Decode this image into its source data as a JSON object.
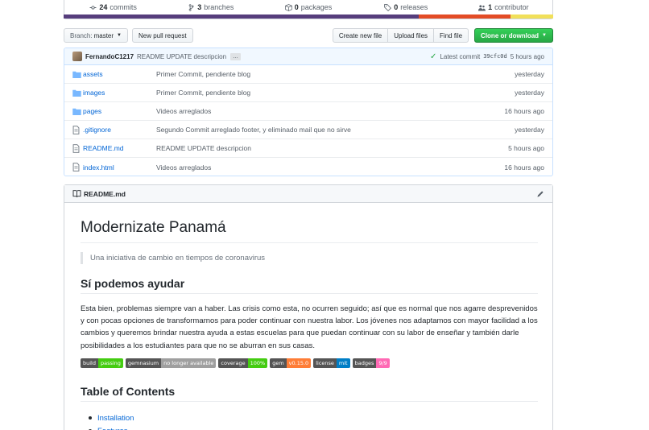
{
  "summary": {
    "commits": {
      "count": "24",
      "label": "commits"
    },
    "branches": {
      "count": "3",
      "label": "branches"
    },
    "packages": {
      "count": "0",
      "label": "packages"
    },
    "releases": {
      "count": "0",
      "label": "releases"
    },
    "contributors": {
      "count": "1",
      "label": "contributor"
    },
    "language_colors": [
      "#563d7c",
      "#e34c26",
      "#f1e05a"
    ]
  },
  "toolbar": {
    "branch_prefix": "Branch:",
    "branch_name": "master",
    "new_pull_request": "New pull request",
    "create_new_file": "Create new file",
    "upload_files": "Upload files",
    "find_file": "Find file",
    "clone_or_download": "Clone or download"
  },
  "latest_commit": {
    "author": "FernandoC1217",
    "message": "README UPDATE descripcion",
    "ellipsis": "…",
    "label": "Latest commit",
    "sha": "39cfc0d",
    "age": "5 hours ago"
  },
  "files": [
    {
      "name": "assets",
      "type": "folder",
      "commit": "Primer Commit, pendiente blog",
      "age": "yesterday"
    },
    {
      "name": "images",
      "type": "folder",
      "commit": "Primer Commit, pendiente blog",
      "age": "yesterday"
    },
    {
      "name": "pages",
      "type": "folder",
      "commit": "Videos arreglados",
      "age": "16 hours ago"
    },
    {
      "name": ".gitignore",
      "type": "file",
      "commit": "Segundo Commit arreglado footer, y eliminado mail que no sirve",
      "age": "yesterday"
    },
    {
      "name": "README.md",
      "type": "file",
      "commit": "README UPDATE descripcion",
      "age": "5 hours ago"
    },
    {
      "name": "index.html",
      "type": "file",
      "commit": "Videos arreglados",
      "age": "16 hours ago"
    }
  ],
  "readme": {
    "filename": "README.md",
    "title": "Modernizate Panamá",
    "tagline": "Una iniciativa de cambio en tiempos de coronavirus",
    "section_heading": "Sí podemos ayudar",
    "paragraph": "Esta bien, problemas siempre van a haber. Las crisis como esta, no ocurren seguido; así que es normal que nos agarre desprevenidos y con pocas opciones de transformarnos para poder continuar con nuestra labor. Los jóvenes nos adaptamos con mayor facilidad a los cambios y queremos brindar nuestra ayuda a estas escuelas para que puedan continuar con su labor de enseñar y también darle posibilidades a los estudiantes para que no se aburran en sus casas.",
    "badges": [
      {
        "label": "build",
        "value": "passing",
        "color": "#4c1"
      },
      {
        "label": "gemnasium",
        "value": "no longer available",
        "color": "#9f9f9f"
      },
      {
        "label": "coverage",
        "value": "100%",
        "color": "#4c1"
      },
      {
        "label": "gem",
        "value": "v0.15.0",
        "color": "#fe7d37"
      },
      {
        "label": "license",
        "value": "mit",
        "color": "#007ec6"
      },
      {
        "label": "badges",
        "value": "9/9",
        "color": "#ff69b4"
      }
    ],
    "toc_heading": "Table of Contents",
    "toc_items": [
      "Installation",
      "Features"
    ]
  }
}
